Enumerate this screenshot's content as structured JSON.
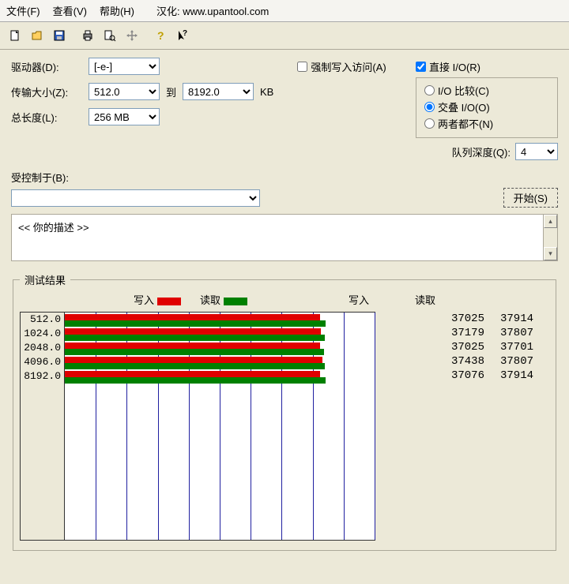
{
  "menu": {
    "file": "文件(F)",
    "view": "查看(V)",
    "help": "帮助(H)",
    "localized": "汉化: www.upantool.com"
  },
  "labels": {
    "drive": "驱动器(D):",
    "transfer_size": "传输大小(Z):",
    "to": "到",
    "kb": "KB",
    "total_length": "总长度(L):",
    "force_write": "强制写入访问(A)",
    "direct_io": "直接 I/O(R)",
    "io_compare": "I/O 比较(C)",
    "overlap_io": "交叠 I/O(O)",
    "neither": "两者都不(N)",
    "queue_depth": "队列深度(Q):",
    "bound_by": "受控制于(B):",
    "start": "开始(S)",
    "description": "<<   你的描述    >>",
    "results": "测试结果",
    "write": "写入",
    "read": "读取"
  },
  "values": {
    "drive": "[-e-]",
    "size_from": "512.0",
    "size_to": "8192.0",
    "total_length": "256 MB",
    "force_write_checked": false,
    "direct_io_checked": true,
    "io_mode": "overlap",
    "queue_depth": "4"
  },
  "chart_data": {
    "type": "bar",
    "orientation": "horizontal",
    "categories": [
      "512.0",
      "1024.0",
      "2048.0",
      "4096.0",
      "8192.0"
    ],
    "series": [
      {
        "name": "写入",
        "color": "#e00000",
        "values": [
          37025,
          37179,
          37025,
          37438,
          37076
        ]
      },
      {
        "name": "读取",
        "color": "#008000",
        "values": [
          37914,
          37807,
          37701,
          37807,
          37914
        ]
      }
    ],
    "xlim": [
      0,
      45000
    ],
    "gridlines": 10
  }
}
